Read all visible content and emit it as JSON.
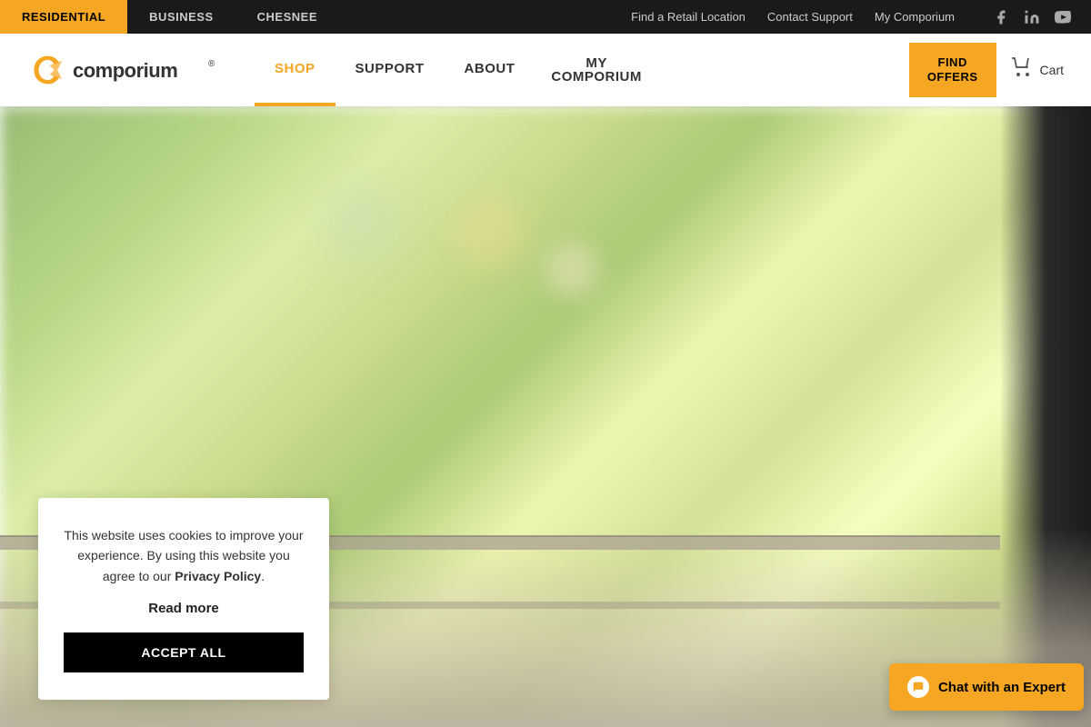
{
  "topbar": {
    "tabs": [
      {
        "id": "residential",
        "label": "RESIDENTIAL",
        "active": true
      },
      {
        "id": "business",
        "label": "BUSINESS",
        "active": false
      },
      {
        "id": "chesnee",
        "label": "CHESNEE",
        "active": false
      }
    ],
    "links": [
      {
        "id": "find-retail",
        "label": "Find a Retail Location"
      },
      {
        "id": "contact-support",
        "label": "Contact Support"
      },
      {
        "id": "my-comporium",
        "label": "My Comporium"
      }
    ],
    "social": [
      {
        "id": "facebook",
        "icon": "f",
        "aria": "Facebook"
      },
      {
        "id": "linkedin",
        "icon": "in",
        "aria": "LinkedIn"
      },
      {
        "id": "youtube",
        "icon": "▶",
        "aria": "YouTube"
      }
    ]
  },
  "nav": {
    "logo_alt": "Comporium",
    "links": [
      {
        "id": "shop",
        "label": "SHOP",
        "active": true
      },
      {
        "id": "support",
        "label": "SUPPORT",
        "active": false
      },
      {
        "id": "about",
        "label": "ABOUT",
        "active": false
      }
    ],
    "my_comporium_label": "MY",
    "my_comporium_sub": "COMPORIUM",
    "find_offers_label": "FIND\nOFFERS",
    "cart_label": "Cart"
  },
  "cookie": {
    "message": "This website uses cookies to improve your experience. By using this website you agree to our ",
    "policy_link": "Privacy Policy",
    "period": ".",
    "read_more": "Read more",
    "accept_all": "ACCEPT ALL"
  },
  "chat": {
    "label": "Chat with an Expert"
  }
}
